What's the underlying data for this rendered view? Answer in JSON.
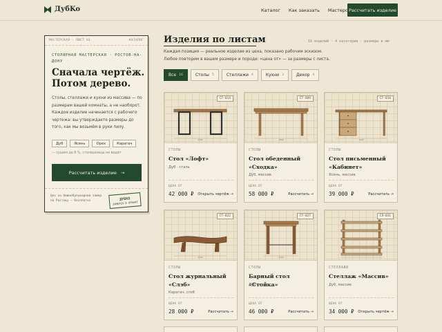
{
  "header": {
    "brand": "ДубKo",
    "nav": [
      "Каталог",
      "Как заказать",
      "Мастерская"
    ],
    "cta": "Рассчитать изделие"
  },
  "hero": {
    "sheet_left": "МАСТЕРСКАЯ · ЛИСТ 01",
    "sheet_right": "КАТАЛОГ",
    "kicker": "СТОЛЯРНАЯ МАСТЕРСКАЯ · РОСТОВ-НА-ДОНУ",
    "title": "Сначала чертёж. Потом дерево.",
    "description": "Столы, стеллажи и кухни из массива — по размерам вашей комнаты, а не наоборот. Каждое изделие начинается с рабочего чертежа: вы утверждаете размеры до того, как мы возьмём в руки пилу.",
    "woods": [
      "Дуб",
      "Ясень",
      "Орех",
      "Карагач"
    ],
    "note": "— сушим до 8 %, столешницы не ведёт",
    "cta": "Рассчитать изделие",
    "footer_note": "Цех на Нижнебульварной замер по Ростову — бесплатно",
    "stamp_main": "ДУБKO",
    "stamp_sub": "ЗАМЕРЕН И ПРИНЯТ"
  },
  "catalog": {
    "title": "Изделия по листам",
    "meta": "16 изделий · 4 категории · размеры в мм",
    "subtitle": "Каждая позиция — реальное изделие из цеха, показано рабочим эскизом. Любое повторим в вашем размере и породе: «цена от» — за размеры с листа.",
    "filters": [
      {
        "label": "Все",
        "count": "16",
        "active": true
      },
      {
        "label": "Столы",
        "count": "5",
        "active": false
      },
      {
        "label": "Стеллажи",
        "count": "4",
        "active": false
      },
      {
        "label": "Кухни",
        "count": "3",
        "active": false
      },
      {
        "label": "Декор",
        "count": "4",
        "active": false
      }
    ],
    "price_label": "ЦЕНА ОТ",
    "products": [
      {
        "sku": "СТ-014",
        "category": "СТОЛЫ",
        "name": "Стол «Лофт»",
        "material": "Дуб · сталь",
        "price": "42 000 ₽",
        "action": "Открыть чертёж",
        "sketch": "loft-table-icon"
      },
      {
        "sku": "СТ-009",
        "category": "СТОЛЫ",
        "name": "Стол обеденный «Сходка»",
        "material": "Дуб, массив",
        "price": "58 000 ₽",
        "action": "Рассчитать",
        "sketch": "dining-table-icon"
      },
      {
        "sku": "СТ-018",
        "category": "СТОЛЫ",
        "name": "Стол письменный «Кабинет»",
        "material": "Ясень, массив",
        "price": "39 000 ₽",
        "action": "Рассчитать",
        "sketch": "desk-icon"
      },
      {
        "sku": "СТ-022",
        "category": "СТОЛЫ",
        "name": "Стол журнальный «Слэб»",
        "material": "Карагач, слэб",
        "price": "28 000 ₽",
        "action": "Рассчитать",
        "sketch": "slab-table-icon"
      },
      {
        "sku": "СТ-027",
        "category": "СТОЛЫ",
        "name": "Барный стол «Стойка»",
        "material": "Дуб · сталь",
        "price": "46 000 ₽",
        "action": "Рассчитать",
        "sketch": "bar-table-icon"
      },
      {
        "sku": "СЛ-031",
        "category": "СТЕЛЛАЖИ",
        "name": "Стеллаж «Массив»",
        "material": "Дуб, массив",
        "price": "34 000 ₽",
        "action": "Открыть чертёж",
        "sketch": "shelf-icon"
      }
    ]
  },
  "colors": {
    "background": "#efe7d6",
    "accent": "#234a2c",
    "wood": "#a87a4a"
  }
}
